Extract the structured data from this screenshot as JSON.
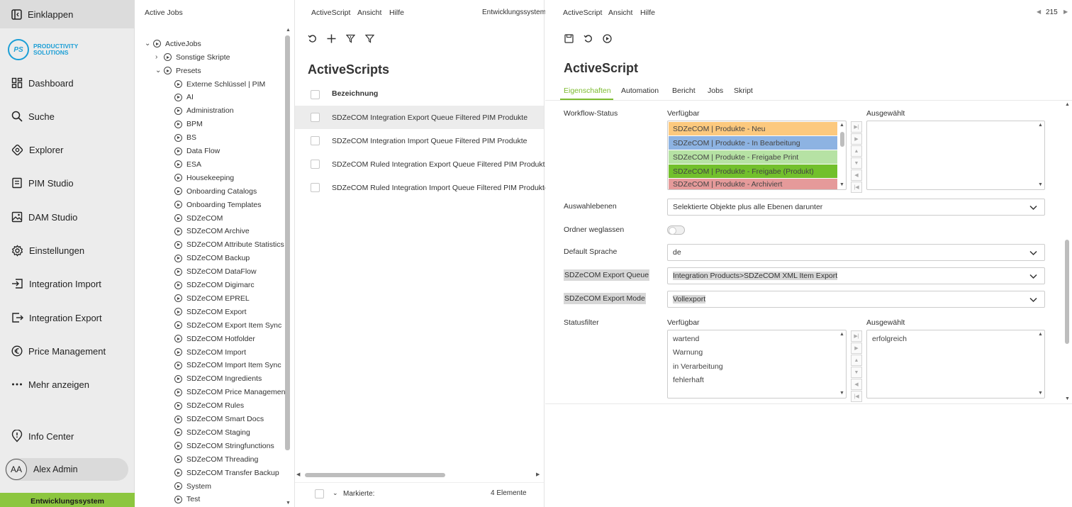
{
  "nav": {
    "collapse": "Einklappen",
    "logo": {
      "initials": "PS",
      "line1": "PRODUCTIVITY",
      "line2": "SOLUTIONS"
    },
    "items": [
      {
        "label": "Dashboard",
        "icon": "dashboard-icon"
      },
      {
        "label": "Suche",
        "icon": "search-icon"
      },
      {
        "label": "Explorer",
        "icon": "explorer-icon"
      },
      {
        "label": "PIM Studio",
        "icon": "pim-studio-icon"
      },
      {
        "label": "DAM Studio",
        "icon": "image-icon"
      },
      {
        "label": "Einstellungen",
        "icon": "gear-icon"
      },
      {
        "label": "Integration Import",
        "icon": "import-icon"
      },
      {
        "label": "Integration Export",
        "icon": "export-icon"
      },
      {
        "label": "Price Management",
        "icon": "euro-icon"
      },
      {
        "label": "Mehr anzeigen",
        "icon": "more-icon"
      }
    ],
    "info_center": "Info Center",
    "user": {
      "initials": "AA",
      "name": "Alex Admin"
    },
    "environment": "Entwicklungssystem"
  },
  "tree": {
    "title": "Active Jobs",
    "root": "ActiveJobs",
    "sonstige": "Sonstige Skripte",
    "presets": "Presets",
    "children": [
      "Externe Schlüssel | PIM",
      "AI",
      "Administration",
      "BPM",
      "BS",
      "Data Flow",
      "ESA",
      "Housekeeping",
      "Onboarding Catalogs",
      "Onboarding Templates",
      "SDZeCOM",
      "SDZeCOM Archive",
      "SDZeCOM Attribute Statistics",
      "SDZeCOM Backup",
      "SDZeCOM DataFlow",
      "SDZeCOM Digimarc",
      "SDZeCOM EPREL",
      "SDZeCOM Export",
      "SDZeCOM Export Item Sync",
      "SDZeCOM Hotfolder",
      "SDZeCOM Import",
      "SDZeCOM Import Item Sync",
      "SDZeCOM Ingredients",
      "SDZeCOM Price Management",
      "SDZeCOM Rules",
      "SDZeCOM Smart Docs",
      "SDZeCOM Staging",
      "SDZeCOM Stringfunctions",
      "SDZeCOM Threading",
      "SDZeCOM Transfer Backup",
      "System",
      "Test"
    ]
  },
  "list": {
    "menu": [
      "ActiveScript",
      "Ansicht",
      "Hilfe"
    ],
    "environment": "Entwicklungssystem",
    "title": "ActiveScripts",
    "column": "Bezeichnung",
    "rows": [
      "SDZeCOM Integration Export Queue Filtered PIM Produkte",
      "SDZeCOM Integration Import Queue Filtered PIM Produkte",
      "SDZeCOM Ruled Integration Export Queue Filtered PIM Produkte",
      "SDZeCOM Ruled Integration Import Queue Filtered PIM Produkte"
    ],
    "footer_marked": "Markierte:",
    "footer_count": "4 Elemente"
  },
  "detail": {
    "menu": [
      "ActiveScript",
      "Ansicht",
      "Hilfe"
    ],
    "page_number": "215",
    "title": "ActiveScript",
    "tabs": [
      "Eigenschaften",
      "Automation",
      "Bericht",
      "Jobs",
      "Skript"
    ],
    "workflow": {
      "label": "Workflow-Status",
      "available_label": "Verfügbar",
      "selected_label": "Ausgewählt",
      "available": [
        {
          "label": "SDZeCOM | Produkte - Neu",
          "color": "#fcc97e"
        },
        {
          "label": "SDZeCOM | Produkte - In Bearbeitung",
          "color": "#8db3e2"
        },
        {
          "label": "SDZeCOM | Produkte - Freigabe Print",
          "color": "#b6e2a4"
        },
        {
          "label": "SDZeCOM | Produkte - Freigabe (Produkt)",
          "color": "#72c02c"
        },
        {
          "label": "SDZeCOM | Produkte - Archiviert",
          "color": "#e59a9a"
        }
      ]
    },
    "auswahlebenen": {
      "label": "Auswahlebenen",
      "value": "Selektierte Objekte plus alle Ebenen darunter"
    },
    "ordner": {
      "label": "Ordner weglassen"
    },
    "sprache": {
      "label": "Default Sprache",
      "value": "de"
    },
    "queue": {
      "label": "SDZeCOM Export Queue",
      "value": "Integration Products>SDZeCOM XML Item Export"
    },
    "mode": {
      "label": "SDZeCOM Export Mode",
      "value": "Vollexport"
    },
    "statusfilter": {
      "label": "Statusfilter",
      "available_label": "Verfügbar",
      "selected_label": "Ausgewählt",
      "available": [
        "wartend",
        "Warnung",
        "in Verarbeitung",
        "fehlerhaft"
      ],
      "selected": [
        "erfolgreich"
      ]
    }
  }
}
